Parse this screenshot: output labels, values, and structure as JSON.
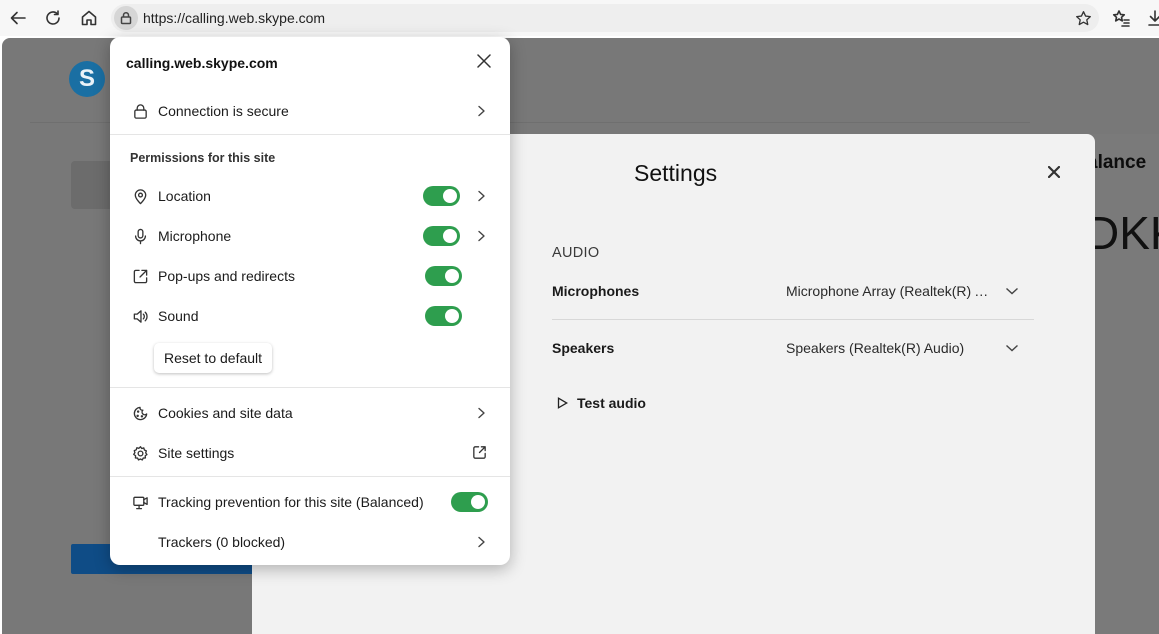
{
  "browser": {
    "url": "https://calling.web.skype.com",
    "icons": [
      "back-icon",
      "refresh-icon",
      "home-icon",
      "lock-icon",
      "star-icon",
      "favorites-icon",
      "download-icon"
    ]
  },
  "background": {
    "logo_letter": "S",
    "balance_fragment": "alance",
    "big_text_fragment": "DKK"
  },
  "settings": {
    "title": "Settings",
    "section": "AUDIO",
    "microphones_label": "Microphones",
    "microphones_value": "Microphone Array (Realtek(R) A...",
    "speakers_label": "Speakers",
    "speakers_value": "Speakers (Realtek(R) Audio)",
    "test_audio": "Test audio"
  },
  "popup": {
    "host": "calling.web.skype.com",
    "connection": "Connection is secure",
    "permissions_title": "Permissions for this site",
    "permissions": [
      {
        "label": "Location",
        "icon": "location-icon",
        "enabled": true
      },
      {
        "label": "Microphone",
        "icon": "microphone-icon",
        "enabled": true
      },
      {
        "label": "Pop-ups and redirects",
        "icon": "popup-icon",
        "enabled": true
      },
      {
        "label": "Sound",
        "icon": "sound-icon",
        "enabled": true
      }
    ],
    "reset_label": "Reset to default",
    "cookies_label": "Cookies and site data",
    "site_settings_label": "Site settings",
    "tracking_label": "Tracking prevention for this site (Balanced)",
    "tracking_enabled": true,
    "trackers_label": "Trackers (0 blocked)",
    "toggle_color": "#2e9e4e"
  }
}
